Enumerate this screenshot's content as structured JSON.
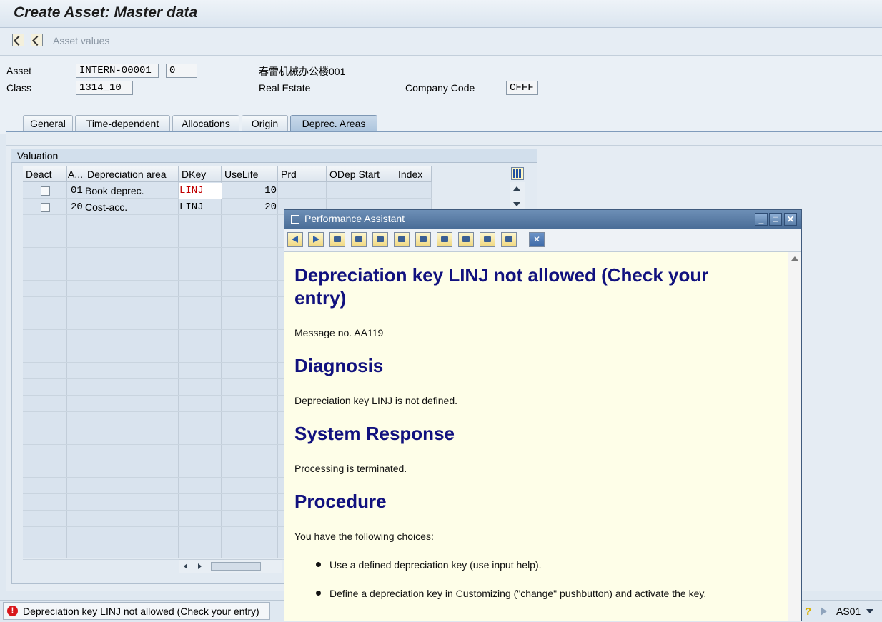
{
  "window": {
    "title": "Create Asset:  Master data"
  },
  "toolbar": {
    "asset_values_label": "Asset values"
  },
  "header": {
    "asset_label": "Asset",
    "asset_number": "INTERN-00001",
    "asset_subnumber": "0",
    "asset_description": "春雷机械办公楼001",
    "class_label": "Class",
    "class_value": "1314_10",
    "class_description": "Real Estate",
    "company_code_label": "Company Code",
    "company_code_value": "CFFF"
  },
  "tabs": [
    {
      "label": "General"
    },
    {
      "label": "Time-dependent"
    },
    {
      "label": "Allocations"
    },
    {
      "label": "Origin"
    },
    {
      "label": "Deprec. Areas"
    }
  ],
  "valuation": {
    "group_title": "Valuation",
    "columns": [
      "Deact",
      "A...",
      "Depreciation area",
      "DKey",
      "UseLife",
      "Prd",
      "ODep Start",
      "Index"
    ],
    "rows": [
      {
        "deact": false,
        "area": "01",
        "area_name": "Book deprec.",
        "dkey": "LINJ",
        "uselife": "10",
        "prd": "",
        "odep_start": "",
        "index": ""
      },
      {
        "deact": false,
        "area": "20",
        "area_name": "Cost-acc.",
        "dkey": "LINJ",
        "uselife": "20",
        "prd": "",
        "odep_start": "",
        "index": ""
      }
    ]
  },
  "popup": {
    "title": "Performance Assistant",
    "heading": "Depreciation key LINJ not allowed (Check your entry)",
    "message_no": "Message no. AA119",
    "diagnosis_title": "Diagnosis",
    "diagnosis_text": "Depreciation key LINJ is not defined.",
    "response_title": "System Response",
    "response_text": "Processing is terminated.",
    "procedure_title": "Procedure",
    "procedure_intro": "You have the following choices:",
    "choices": [
      "Use a defined depreciation key (use input help).",
      "Define a depreciation key in Customizing (\"change\" pushbutton) and activate the key."
    ]
  },
  "statusbar": {
    "message": "Depreciation key LINJ not allowed (Check your entry)",
    "message_type": "error",
    "system_id": "AS01"
  },
  "colors": {
    "error_red": "#d8161b",
    "heading_navy": "#11117e",
    "invalid_value_red": "#c00000",
    "popup_background": "#fefee8"
  }
}
